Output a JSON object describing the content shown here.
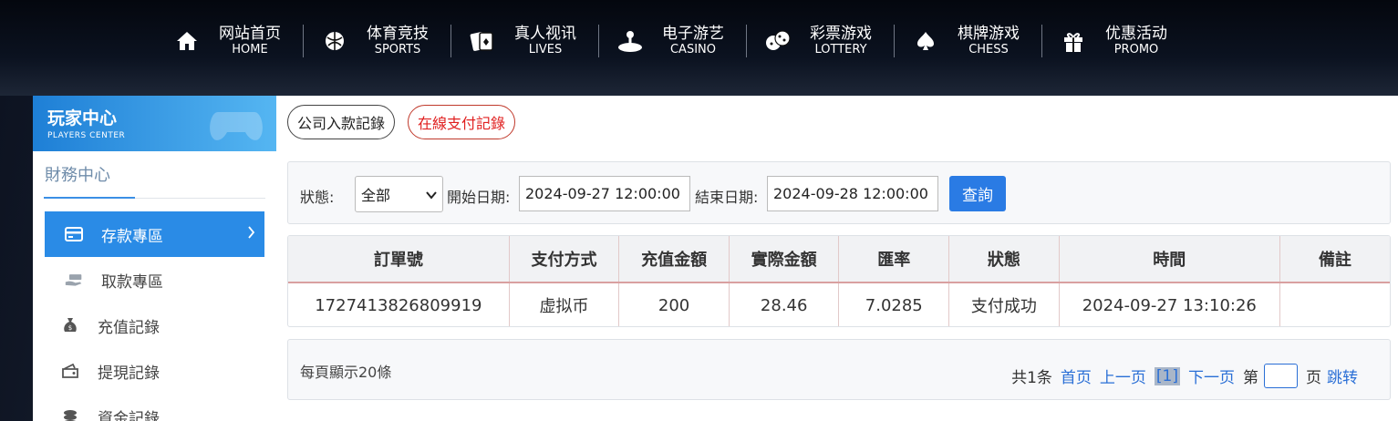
{
  "nav": {
    "items": [
      {
        "cn": "网站首页",
        "en": "HOME",
        "icon": "home-icon"
      },
      {
        "cn": "体育竞技",
        "en": "SPORTS",
        "icon": "ball-icon"
      },
      {
        "cn": "真人视讯",
        "en": "LIVES",
        "icon": "cards-icon"
      },
      {
        "cn": "电子游艺",
        "en": "CASINO",
        "icon": "joystick-icon"
      },
      {
        "cn": "彩票游戏",
        "en": "LOTTERY",
        "icon": "dice-icon"
      },
      {
        "cn": "棋牌游戏",
        "en": "CHESS",
        "icon": "spade-icon"
      },
      {
        "cn": "优惠活动",
        "en": "PROMO",
        "icon": "gift-icon"
      }
    ]
  },
  "sidebar": {
    "title": "玩家中心",
    "subtitle": "PLAYERS CENTER",
    "section": "財務中心",
    "items": [
      {
        "label": "存款專區",
        "icon": "card-icon",
        "active": true
      },
      {
        "label": "取款專區",
        "icon": "cash-icon",
        "active": false
      },
      {
        "label": "充值記錄",
        "icon": "money-bag-icon",
        "active": false
      },
      {
        "label": "提現記錄",
        "icon": "wallet-icon",
        "active": false
      },
      {
        "label": "資金記錄",
        "icon": "coins-icon",
        "active": false
      }
    ]
  },
  "tabs": {
    "company": "公司入款記錄",
    "online": "在線支付記錄"
  },
  "filter": {
    "status_label": "狀態:",
    "status_value": "全部",
    "start_label": "開始日期:",
    "start_value": "2024-09-27 12:00:00",
    "end_label": "結束日期:",
    "end_value": "2024-09-28 12:00:00",
    "query_button": "查詢"
  },
  "table": {
    "headers": [
      "訂單號",
      "支付方式",
      "充值金額",
      "實際金額",
      "匯率",
      "狀態",
      "時間",
      "備註"
    ],
    "rows": [
      [
        "1727413826809919",
        "虚拟币",
        "200",
        "28.46",
        "7.0285",
        "支付成功",
        "2024-09-27 13:10:26",
        ""
      ]
    ]
  },
  "pager": {
    "per_page": "每頁顯示20條",
    "total": "共1条",
    "first": "首页",
    "prev": "上一页",
    "current": "[1]",
    "next": "下一页",
    "goto_prefix": "第",
    "goto_suffix": "页",
    "jump": "跳转"
  },
  "colors": {
    "accent": "#2a8be6",
    "query_button": "#2a7be4",
    "online_tab": "#e02020",
    "link": "#2a6fd6"
  }
}
